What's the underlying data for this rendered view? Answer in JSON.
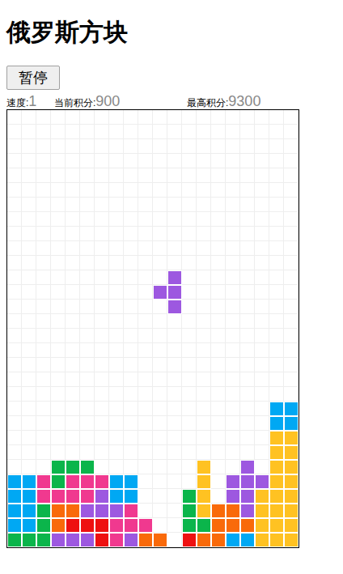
{
  "title": "俄罗斯方块",
  "pause_button": "暂停",
  "stats": [
    {
      "label": "速度:",
      "value": "1"
    },
    {
      "label": "当前积分:",
      "value": "900"
    },
    {
      "label": "最高积分:",
      "value": "9300"
    }
  ],
  "board": {
    "palette": {
      "b": "#00a8f3",
      "p": "#f0398f",
      "g": "#0bb54b",
      "o": "#f96a0a",
      "r": "#ee1111",
      "v": "#9d58e0",
      "y": "#ffc222"
    },
    "rows": [
      "....................",
      "....................",
      "....................",
      "....................",
      "....................",
      "....................",
      "....................",
      "....................",
      "....................",
      "....................",
      "....................",
      "...........v........",
      "..........vv........",
      "...........v........",
      "....................",
      "....................",
      "....................",
      "....................",
      "....................",
      "....................",
      "..................bb",
      "..................bb",
      "..................yy",
      "..................yy",
      "...ggg.......y..v.yy",
      "bbpgpppbb....y.vvvyy",
      "bbppppvbb...gy.vvyyy",
      "bbgoovvvp...gyoovyyy",
      "bbgorrrppp..ggoooyyy",
      "gggvvvrpvoo.roobbyyy"
    ]
  }
}
